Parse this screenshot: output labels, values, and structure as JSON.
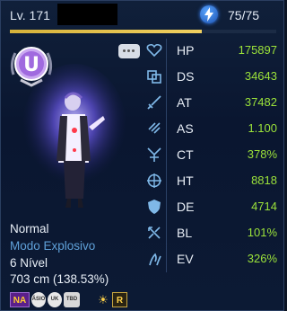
{
  "header": {
    "level_label": "Lv. 171",
    "energy": "75/75",
    "xp_progress_percent": 72
  },
  "character": {
    "type": "Normal",
    "mode": "Modo Explosivo",
    "nivel": "6 Nível",
    "height": "703 cm (138.53%)"
  },
  "badges": {
    "na": "NA",
    "c1": "ÁSIO",
    "c2": "UK",
    "c3": "TBD",
    "r": "R"
  },
  "stats": [
    {
      "abbr": "HP",
      "value": "175897",
      "icon": "heart-icon"
    },
    {
      "abbr": "DS",
      "value": "34643",
      "icon": "ds-icon"
    },
    {
      "abbr": "AT",
      "value": "37482",
      "icon": "sword-icon"
    },
    {
      "abbr": "AS",
      "value": "1.100",
      "icon": "speed-icon"
    },
    {
      "abbr": "CT",
      "value": "378%",
      "icon": "critical-icon"
    },
    {
      "abbr": "HT",
      "value": "8818",
      "icon": "crosshair-icon"
    },
    {
      "abbr": "DE",
      "value": "4714",
      "icon": "shield-icon"
    },
    {
      "abbr": "BL",
      "value": "101%",
      "icon": "block-icon"
    },
    {
      "abbr": "EV",
      "value": "326%",
      "icon": "evade-icon"
    }
  ],
  "colors": {
    "stat_value": "#9be23a",
    "mode_text": "#5fa0d8",
    "accent_energy": "#3a86ff"
  }
}
